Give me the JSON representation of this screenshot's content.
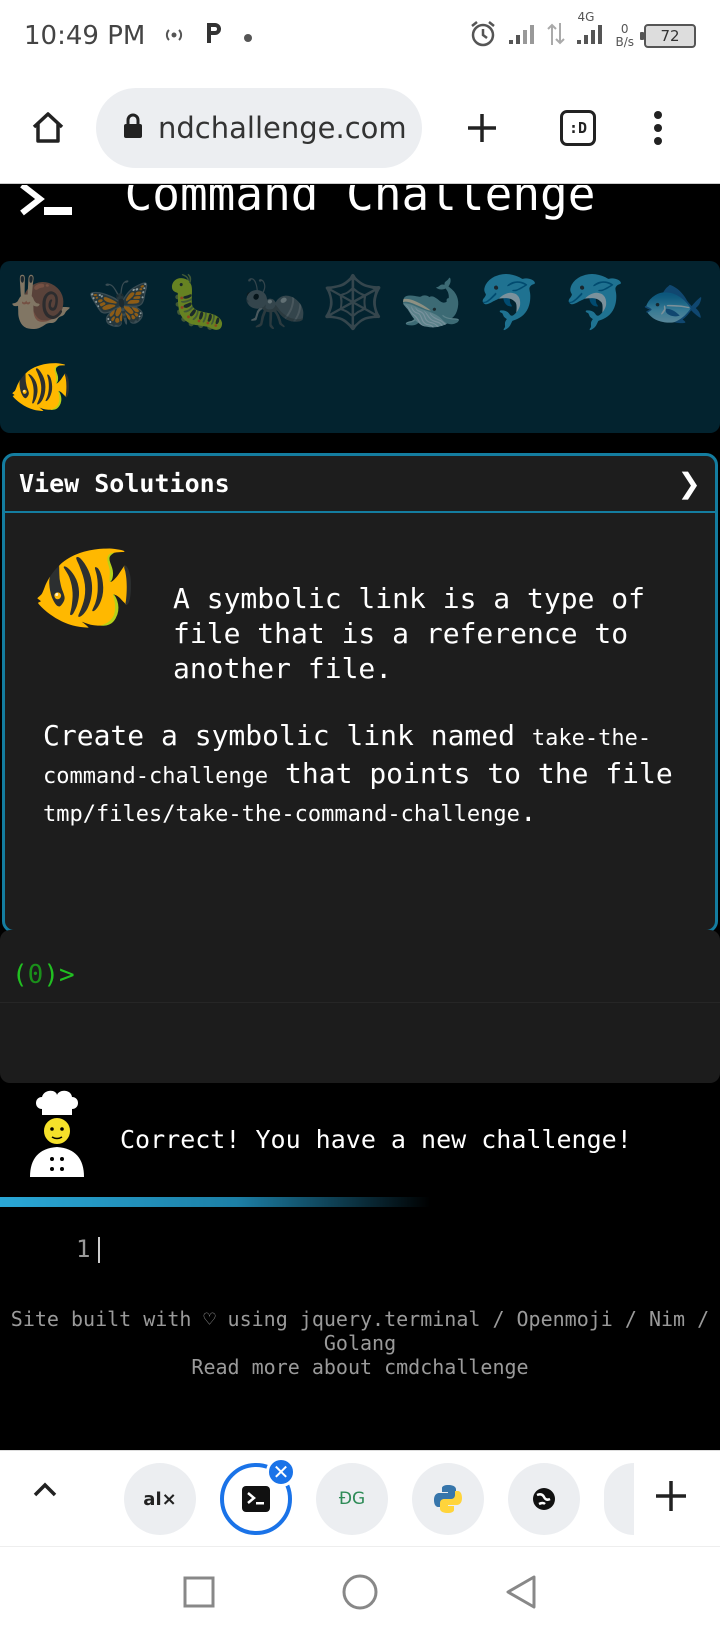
{
  "status_bar": {
    "time": "10:49 PM",
    "net_speed_value": "0",
    "net_speed_unit": "B/s",
    "network_type": "4G",
    "battery": "72",
    "icons": [
      "hotspot-icon",
      "p-app-icon",
      "dot-icon",
      "alarm-icon",
      "signal-icon",
      "data-arrows-icon",
      "signal-icon",
      "battery-icon"
    ]
  },
  "browser": {
    "url": "ndchallenge.com",
    "tab_badge": ":D"
  },
  "site": {
    "title": "Command Challenge",
    "animals": [
      "🐌",
      "🦋",
      "🐛",
      "🐜",
      "🕸️",
      "🐋",
      "🐬",
      "🐬",
      "🐟",
      "🐠"
    ],
    "view_solutions": "View Solutions",
    "chevron": "❯",
    "current_animal": "🐠",
    "lead_text": "A symbolic link is a type of file that is a reference to another file.",
    "desc_part1": "Create a symbolic link named ",
    "desc_code1": "take-the-command-challenge",
    "desc_part2": " that points to the file ",
    "desc_code2": "tmp/files/take-the-command-challenge",
    "desc_part3": ".",
    "prompt_open": "(",
    "prompt_count": "0",
    "prompt_close": ")>",
    "feedback": "Correct! You have a new challenge!",
    "progress_fraction": 0.6,
    "editor_line_number": "1",
    "footer_line1": "Site built with ♡ using jquery.terminal / Openmoji / Nim / Golang",
    "footer_line2": "Read more about cmdchallenge"
  },
  "tabstrip": {
    "tabs": [
      {
        "label": "al×"
      },
      {
        "label": "terminal"
      },
      {
        "label": "ÐG"
      },
      {
        "label": "python"
      },
      {
        "label": "globe"
      }
    ],
    "close": "✕"
  }
}
